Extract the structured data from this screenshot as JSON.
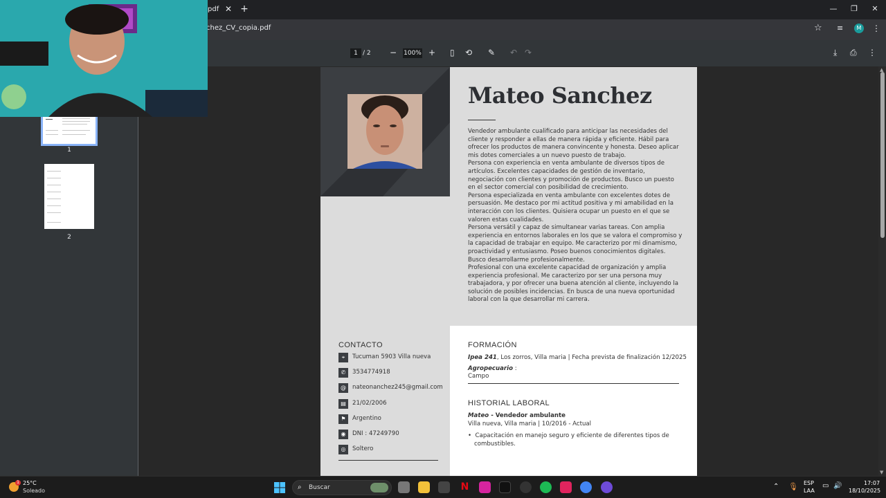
{
  "browser": {
    "tab_title": "pdf",
    "tab_close": "✕",
    "new_tab": "+",
    "url": "chez_CV_copia.pdf",
    "profile_initial": "M"
  },
  "pdf_toolbar": {
    "current_page": "1",
    "total_pages": "/  2",
    "zoom": "100%"
  },
  "thumbnails": [
    {
      "label": "1"
    },
    {
      "label": "2"
    }
  ],
  "cv": {
    "name": "Mateo Sanchez",
    "summary": "Vendedor ambulante cualificado para anticipar las necesidades del cliente y responder a ellas de manera rápida y eficiente. Hábil para ofrecer los productos de manera convincente y honesta. Deseo aplicar mis dotes comerciales a un nuevo puesto de trabajo.\nPersona con experiencia en venta ambulante de diversos tipos de artículos. Excelentes capacidades de gestión de inventario, negociación con clientes y promoción de productos. Busco un puesto en el sector comercial con posibilidad de crecimiento.\nPersona especializada en venta ambulante con excelentes dotes de persuasión. Me destaco por mi actitud positiva y mi amabilidad en la interacción con los clientes. Quisiera ocupar un puesto en el que se valoren estas cualidades.\nPersona versátil y capaz de simultanear varias tareas. Con amplia experiencia en entornos laborales en los que se valora el compromiso y la capacidad de trabajar en equipo. Me caracterizo por mi dinamismo, proactividad y entusiasmo. Poseo buenos conocimientos digitales. Busco desarrollarme profesionalmente.\nProfesional con una excelente capacidad de organización y amplia experiencia profesional. Me caracterizo por ser una persona muy trabajadora, y por ofrecer una buena atención al cliente, incluyendo la solución de posibles incidencias. En busca de una nueva oportunidad laboral con la que desarrollar mi carrera.",
    "contact_title": "CONTACTO",
    "contact": [
      {
        "icon": "location-pin-icon",
        "glyph": "⌖",
        "text": "Tucuman 5903 Villa nueva"
      },
      {
        "icon": "phone-icon",
        "glyph": "✆",
        "text": "3534774918"
      },
      {
        "icon": "email-icon",
        "glyph": "@",
        "text": "nateonanchez245@gmail.com"
      },
      {
        "icon": "birthday-icon",
        "glyph": "▤",
        "text": "21/02/2006"
      },
      {
        "icon": "flag-icon",
        "glyph": "⚑",
        "text": "Argentino"
      },
      {
        "icon": "id-icon",
        "glyph": "◉",
        "text": "DNI : 47249790"
      },
      {
        "icon": "rings-icon",
        "glyph": "◎",
        "text": "Soltero"
      }
    ],
    "formacion_title": "FORMACIÓN",
    "formacion": {
      "school": "Ipea 241",
      "detail": ", Los zorros, Villa maria | Fecha prevista de finalización 12/2025",
      "field": "Agropecuario",
      "field_suffix": " :",
      "field_value": "Campo"
    },
    "historial_title": "HISTORIAL LABORAL",
    "historial": {
      "employer": "Mateo",
      "role": " - Vendedor ambulante",
      "location": "Villa nueva, Villa maria | 10/2016 - Actual",
      "bullet_1": "Capacitación en manejo seguro y eficiente de diferentes tipos de",
      "bullet_2": "combustibles."
    }
  },
  "taskbar": {
    "temperature": "25°C",
    "condition": "Soleado",
    "weather_badge": "1",
    "search_placeholder": "Buscar",
    "language": "ESP",
    "layout": "LAA",
    "time": "17:07",
    "date": "18/10/2025"
  },
  "colors": {
    "accent": "#8ab4f8",
    "cv_dark": "#3b3e42",
    "cv_panel": "#dcdcdc"
  }
}
